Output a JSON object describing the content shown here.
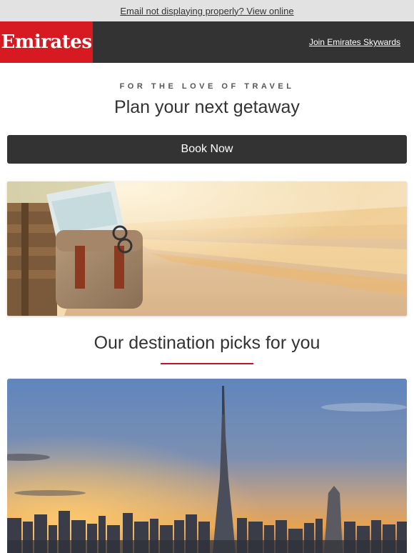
{
  "topbar": {
    "view_online": "Email not displaying properly? View online"
  },
  "header": {
    "logo_text": "Emirates",
    "join_link": "Join Emirates Skywards"
  },
  "intro": {
    "eyebrow": "FOR THE LOVE OF TRAVEL",
    "headline": "Plan your next getaway"
  },
  "cta": {
    "book_label": "Book Now"
  },
  "destinations": {
    "title": "Our destination picks for you"
  },
  "colors": {
    "brand_red": "#d71921",
    "header_bg": "#333333",
    "topbar_bg": "#e2e2e2",
    "rule_red": "#c8102e"
  }
}
